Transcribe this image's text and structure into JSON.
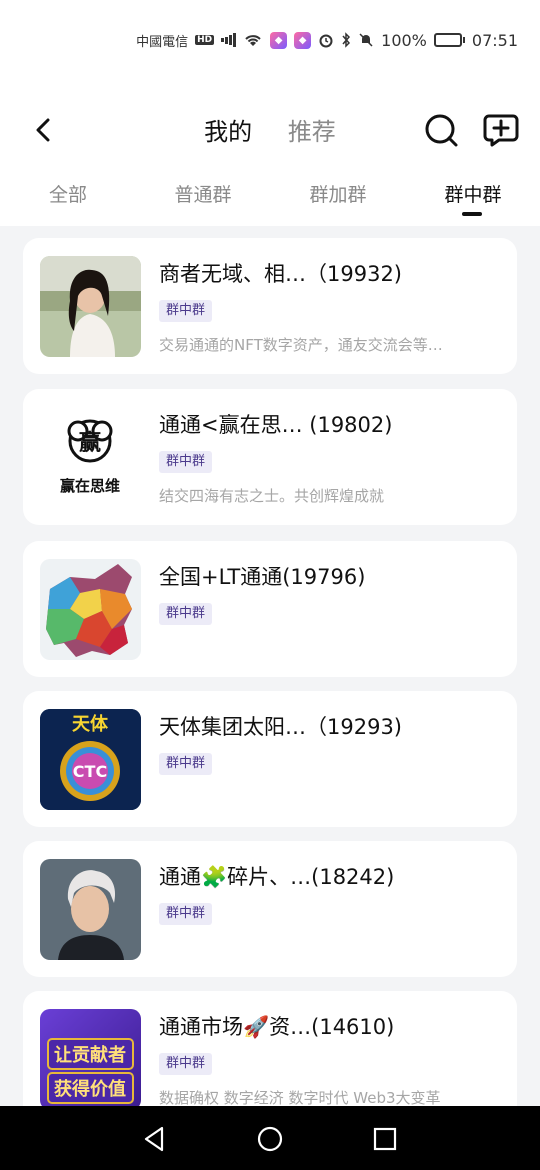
{
  "status_bar": {
    "carrier": "中國電信",
    "hd": "HD",
    "battery": "100%",
    "time": "07:51",
    "app_icon_1": "app-badge-icon",
    "app_icon_2": "app-badge-icon"
  },
  "header": {
    "tabs": [
      {
        "label": "我的",
        "active": true
      },
      {
        "label": "推荐",
        "active": false
      }
    ],
    "icons": {
      "back": "back-arrow-icon",
      "search": "search-icon",
      "add_group": "add-group-chat-icon"
    }
  },
  "category_tabs": [
    {
      "label": "全部",
      "active": false
    },
    {
      "label": "普通群",
      "active": false
    },
    {
      "label": "群加群",
      "active": false
    },
    {
      "label": "群中群",
      "active": true
    }
  ],
  "groups": [
    {
      "title": "商者无域、相…（19932)",
      "tag": "群中群",
      "desc": "交易通通的NFT数字资产，通友交流会等…",
      "avatar": "portrait-photo"
    },
    {
      "title": "通通<赢在思…  (19802)",
      "tag": "群中群",
      "desc": "结交四海有志之士。共创辉煌成就",
      "avatar": "logo",
      "avatar_text": "赢在思维",
      "avatar_glyph": "赢"
    },
    {
      "title": "全国+LT通通(19796)",
      "tag": "群中群",
      "desc": "",
      "avatar": "map"
    },
    {
      "title": "天体集团太阳…（19293)",
      "tag": "群中群",
      "desc": "",
      "avatar": "coin-logo",
      "avatar_top": "天体",
      "avatar_coin": "CTC"
    },
    {
      "title": "通通🧩碎片、…(18242)",
      "tag": "群中群",
      "desc": "",
      "avatar": "portrait-photo"
    },
    {
      "title": "通通市场🚀资…(14610)",
      "tag": "群中群",
      "desc": "数据确权 数字经济 数字时代 Web3大变革",
      "avatar": "poster",
      "avatar_line1": "让贡献者",
      "avatar_line2": "获得价值"
    }
  ],
  "nav_bar": {
    "back": "nav-back-icon",
    "home": "nav-home-icon",
    "recents": "nav-recents-icon"
  }
}
